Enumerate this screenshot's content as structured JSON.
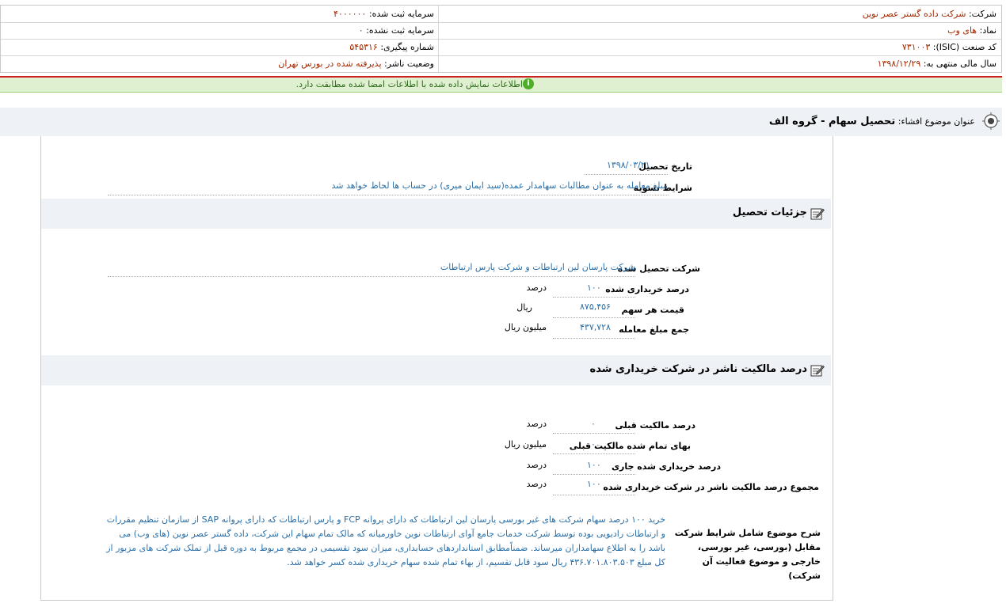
{
  "header": {
    "company_label": "شرکت:",
    "company_value": "شرکت داده گستر عصر نوین",
    "symbol_label": "نماد:",
    "symbol_value": "های وب",
    "isic_label": "کد صنعت (ISIC):",
    "isic_value": "۷۳۱۰۰۳",
    "fiscal_label": "سال مالی منتهی به:",
    "fiscal_value": "۱۳۹۸/۱۲/۲۹",
    "registered_capital_label": "سرمایه ثبت شده:",
    "registered_capital_value": "۴۰۰۰۰۰۰",
    "unregistered_capital_label": "سرمایه ثبت نشده:",
    "unregistered_capital_value": "۰",
    "tracking_label": "شماره پیگیری:",
    "tracking_value": "۵۴۵۳۱۶",
    "publisher_status_label": "وضعیت ناشر:",
    "publisher_status_value": "پذیرفته شده در بورس تهران"
  },
  "notice": {
    "text": "اطلاعات نمایش داده شده با اطلاعات امضا شده مطابقت دارد.",
    "icon": "info-icon"
  },
  "topic": {
    "label": "عنوان موضوع افشاء:",
    "value": "تحصیل سهام - گروه الف"
  },
  "acquisition": {
    "date_label": "تاریخ تحصیل",
    "date_value": "۱۳۹۸/۰۳/۲۱",
    "settlement_label": "شرایط تسویه",
    "settlement_value": "مبلغ معامله به عنوان مطالبات سهامدار عمده(سید ایمان میری) در حساب ها لحاظ خواهد شد"
  },
  "details": {
    "title": "جزئیات تحصیل",
    "company_label": "شرکت تحصیل شده",
    "company_value": "شرکت پارسان لین ارتباطات و شرکت پارس ارتباطات",
    "percent_label": "درصد خریداری شده",
    "percent_value": "۱۰۰",
    "percent_unit": "درصد",
    "price_label": "قیمت هر سهم",
    "price_value": "۸۷۵,۴۵۶",
    "price_unit": "ریال",
    "total_label": "جمع مبلغ معامله",
    "total_value": "۴۳۷,۷۲۸",
    "total_unit": "میلیون ریال"
  },
  "ownership": {
    "title": "درصد مالکیت ناشر در شرکت خریداری شده",
    "prev_percent_label": "درصد مالکیت قبلی",
    "prev_percent_value": "۰",
    "prev_percent_unit": "درصد",
    "prev_cost_label": "بهای تمام شده مالکیت قبلی",
    "prev_cost_value": "۰",
    "prev_cost_unit": "میلیون ریال",
    "current_label": "درصد خریداری شده جاری",
    "current_value": "۱۰۰",
    "current_unit": "درصد",
    "sum_label": "مجموع درصد مالکیت ناشر در شرکت خریداری شده",
    "sum_value": "۱۰۰",
    "sum_unit": "درصد"
  },
  "description": {
    "label": "شرح موضوع شامل شرایط شرکت مقابل (بورسی، غیر بورسی، خارجی و موضوع فعالیت آن شرکت)",
    "text": "خرید ۱۰۰ درصد سهام شرکت های غیر بورسی پارسان لین ارتباطات که دارای پروانه FCP و پارس ارتباطات که دارای پروانه SAP از سازمان تنظیم مقررات و ارتباطات رادیویی بوده توسط شرکت خدمات جامع آوای ارتباطات نوین خاورمیانه که مالک تمام سهام این شرکت، داده گستر عصر نوین (های وب) می باشد را به اطلاع سهامداران میرساند. ضمناًمطابق استانداردهای حسابداری، میزان سود تقسیمی در مجمع مربوط به دوره قبل از تملک شرکت های مزبور از کل مبلغ ۴۳۶.۷۰۱.۸۰۳.۵۰۳ ریال سود قابل تقسیم، از بهاء تمام شده سهام خریداری شده کسر خواهد شد."
  }
}
